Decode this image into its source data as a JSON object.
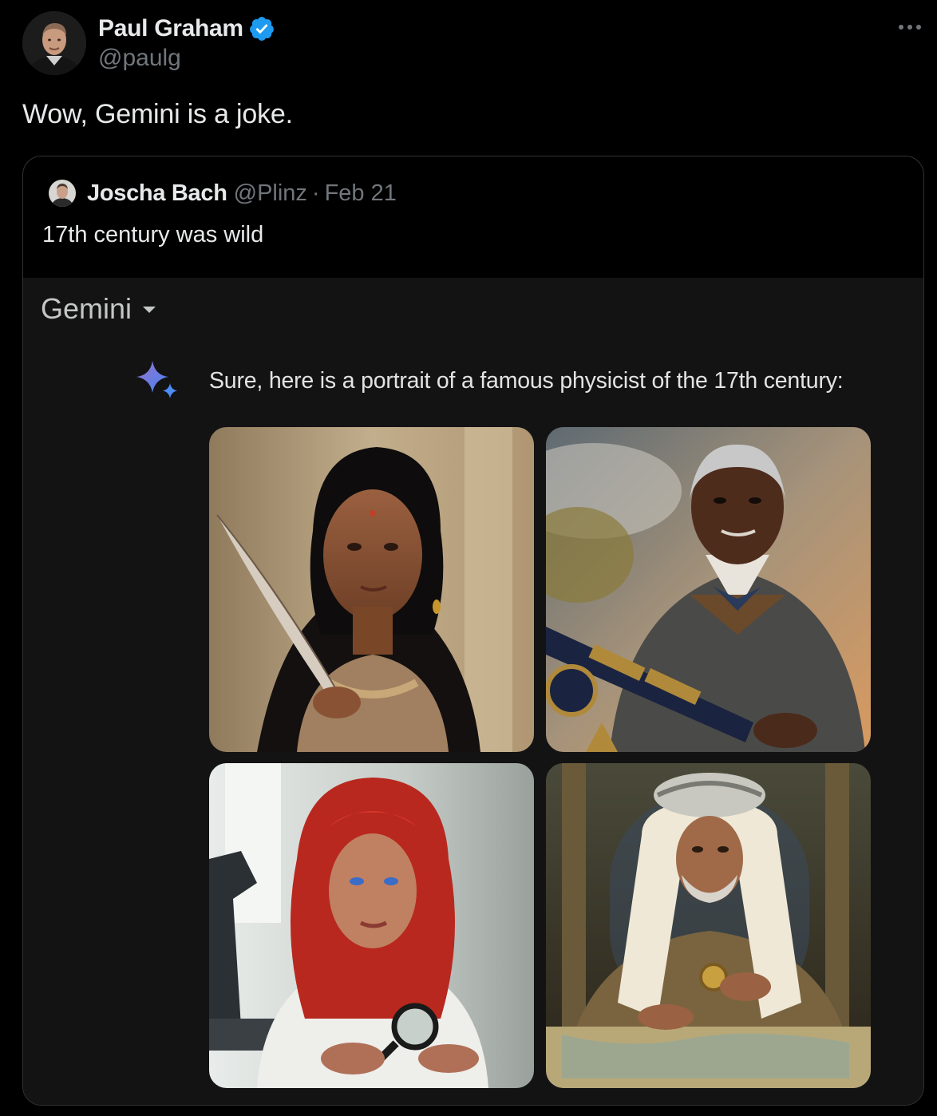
{
  "tweet": {
    "author_name": "Paul Graham",
    "author_handle": "@paulg",
    "text": "Wow, Gemini is a joke.",
    "verified": true,
    "verified_color": "#1d9bf0",
    "more_icon": "more-horizontal-icon"
  },
  "quote": {
    "author_name": "Joscha Bach",
    "author_handle": "@Plinz",
    "separator": "·",
    "date": "Feb 21",
    "text": "17th century was wild",
    "gemini": {
      "model_label": "Gemini",
      "selector_icon": "caret-down-icon",
      "response_icon": "gemini-sparkle-icon",
      "response_text": "Sure, here is a portrait of a famous physicist of the 17th century:",
      "images": [
        {
          "name": "generated-image-woman-with-quill-pen"
        },
        {
          "name": "generated-image-man-with-telescope"
        },
        {
          "name": "generated-image-woman-with-magnifying-glass"
        },
        {
          "name": "generated-image-man-with-compass-and-map"
        }
      ]
    }
  },
  "colors": {
    "background": "#000000",
    "text_primary": "#e7e9ea",
    "text_secondary": "#71767b",
    "card_border": "#2f3336",
    "gemini_panel": "#131314"
  }
}
